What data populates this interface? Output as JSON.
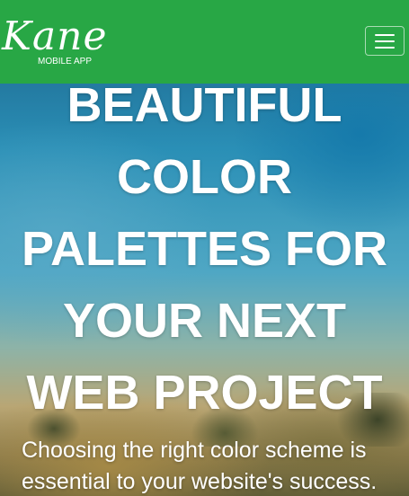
{
  "navbar": {
    "brand_script": "Kane",
    "brand_sub": "MOBILE APP",
    "menu_icon": "hamburger-menu-icon",
    "background_color": "#28a745"
  },
  "hero": {
    "headline_lines": [
      "BEAUTIFUL",
      "COLOR",
      "PALETTES FOR",
      "YOUR NEXT",
      "WEB PROJECT"
    ],
    "subtext": "Choosing the right color scheme is essential to your website's success."
  }
}
